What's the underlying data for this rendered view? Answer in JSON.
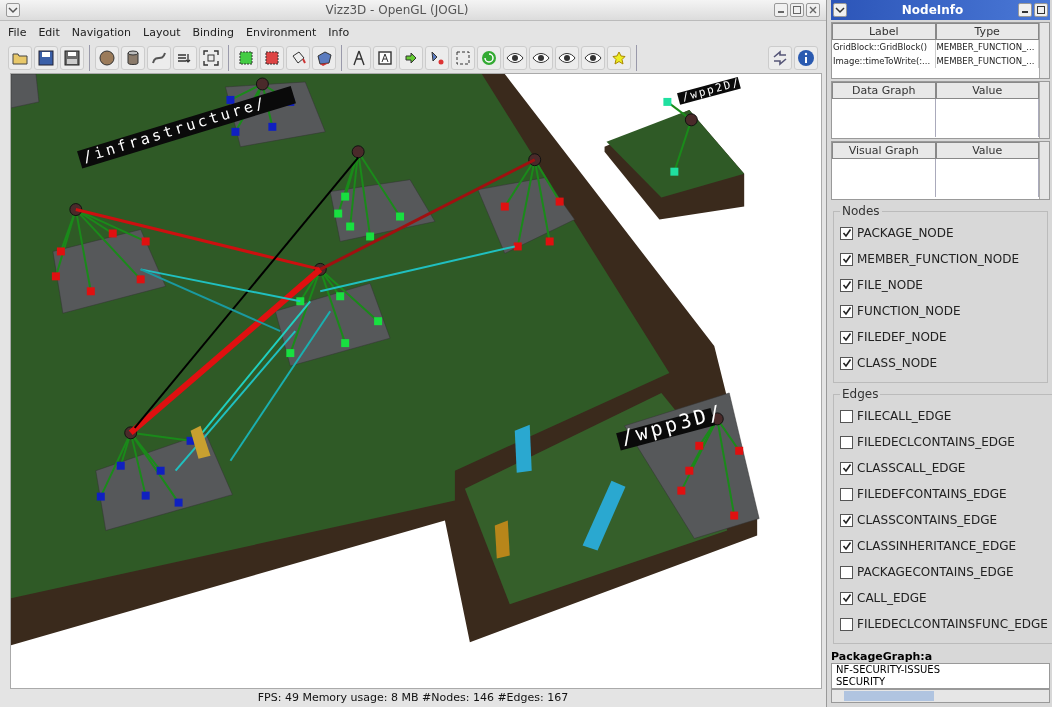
{
  "window": {
    "title": "Vizz3D - OpenGL (JOGL)"
  },
  "menu": [
    "File",
    "Edit",
    "Navigation",
    "Layout",
    "Binding",
    "Environment",
    "Info"
  ],
  "scene": {
    "labels": [
      {
        "text": "/infrastructure/",
        "kind": "large"
      },
      {
        "text": "/wpp2D/",
        "kind": "small"
      },
      {
        "text": "/wpp3D/",
        "kind": "large"
      }
    ]
  },
  "status_bar": "FPS: 49   Memory usage: 8 MB  #Nodes: 146 #Edges: 167",
  "node_info": {
    "title": "NodeInfo",
    "table": {
      "columns": [
        "Label",
        "Type"
      ],
      "rows": [
        [
          "GridBlock::GridBlock()",
          "MEMBER_FUNCTION_..."
        ],
        [
          "Image::timeToWrite(:...",
          "MEMBER_FUNCTION_..."
        ]
      ]
    },
    "data_graph": {
      "columns": [
        "Data Graph",
        "Value"
      ]
    },
    "visual_graph": {
      "columns": [
        "Visual Graph",
        "Value"
      ]
    },
    "nodes": {
      "title": "Nodes",
      "items": [
        {
          "label": "PACKAGE_NODE",
          "checked": true
        },
        {
          "label": "MEMBER_FUNCTION_NODE",
          "checked": true
        },
        {
          "label": "FILE_NODE",
          "checked": true
        },
        {
          "label": "FUNCTION_NODE",
          "checked": true
        },
        {
          "label": "FILEDEF_NODE",
          "checked": true
        },
        {
          "label": "CLASS_NODE",
          "checked": true
        }
      ]
    },
    "edges": {
      "title": "Edges",
      "items": [
        {
          "label": "FILECALL_EDGE",
          "checked": false
        },
        {
          "label": "FILEDECLCONTAINS_EDGE",
          "checked": false
        },
        {
          "label": "CLASSCALL_EDGE",
          "checked": true
        },
        {
          "label": "FILEDEFCONTAINS_EDGE",
          "checked": false
        },
        {
          "label": "CLASSCONTAINS_EDGE",
          "checked": true
        },
        {
          "label": "CLASSINHERITANCE_EDGE",
          "checked": true
        },
        {
          "label": "PACKAGECONTAINS_EDGE",
          "checked": false
        },
        {
          "label": "CALL_EDGE",
          "checked": true
        },
        {
          "label": "FILEDECLCONTAINSFUNC_EDGE",
          "checked": false
        }
      ]
    },
    "package_graph": {
      "title": "PackageGraph:a",
      "items": [
        "NF-SECURITY-ISSUES",
        "SECURITY"
      ]
    }
  }
}
